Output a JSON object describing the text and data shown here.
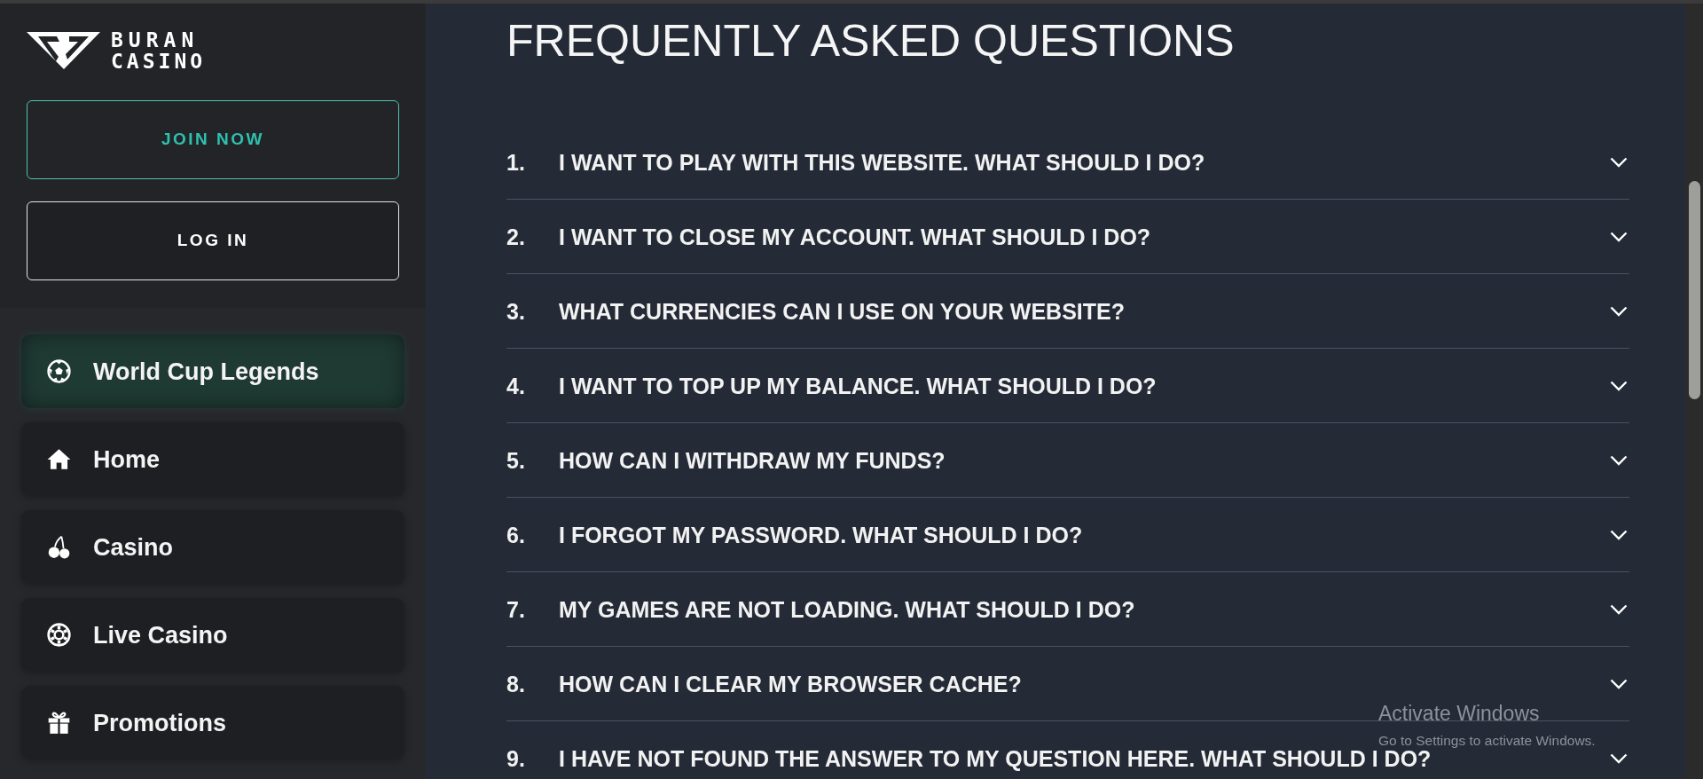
{
  "brand": {
    "line_1": "BURAN",
    "line_2": "CASINO"
  },
  "auth_buttons": [
    {
      "label": "JOIN NOW",
      "kind": "primary"
    },
    {
      "label": "LOG IN",
      "kind": "secondary"
    }
  ],
  "sidebar": {
    "items": [
      {
        "label": "World Cup Legends",
        "selected": true
      },
      {
        "label": "Home",
        "selected": false
      },
      {
        "label": "Casino",
        "selected": false
      },
      {
        "label": "Live Casino",
        "selected": false
      },
      {
        "label": "Promotions",
        "selected": false
      }
    ]
  },
  "faq": {
    "title": "FREQUENTLY ASKED QUESTIONS",
    "items": [
      {
        "number": "1.",
        "question": "I WANT TO PLAY WITH THIS WEBSITE. WHAT SHOULD I DO?",
        "expanded": false
      },
      {
        "number": "2.",
        "question": "I WANT TO CLOSE MY ACCOUNT. WHAT SHOULD I DO?",
        "expanded": false
      },
      {
        "number": "3.",
        "question": "WHAT CURRENCIES CAN I USE ON YOUR WEBSITE?",
        "expanded": false
      },
      {
        "number": "4.",
        "question": "I WANT TO TOP UP MY BALANCE. WHAT SHOULD I DO?",
        "expanded": false
      },
      {
        "number": "5.",
        "question": "HOW CAN I WITHDRAW MY FUNDS?",
        "expanded": false
      },
      {
        "number": "6.",
        "question": "I FORGOT MY PASSWORD. WHAT SHOULD I DO?",
        "expanded": false
      },
      {
        "number": "7.",
        "question": "MY GAMES ARE NOT LOADING. WHAT SHOULD I DO?",
        "expanded": false
      },
      {
        "number": "8.",
        "question": "HOW CAN I CLEAR MY BROWSER CACHE?",
        "expanded": false
      },
      {
        "number": "9.",
        "question": "I HAVE NOT FOUND THE ANSWER TO MY QUESTION HERE. WHAT SHOULD I DO?",
        "expanded": false
      }
    ]
  },
  "os_overlay": {
    "title": "Activate Windows",
    "subtitle": "Go to Settings to activate Windows."
  }
}
